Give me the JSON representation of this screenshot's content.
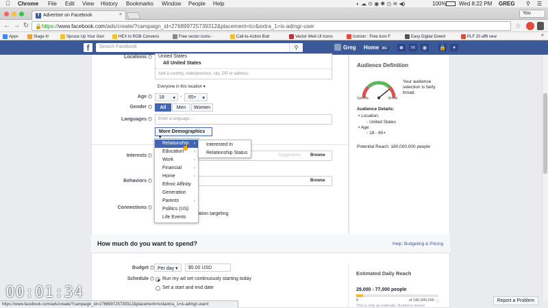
{
  "menubar": {
    "app": "Chrome",
    "items": [
      "File",
      "Edit",
      "View",
      "History",
      "Bookmarks",
      "Window",
      "People",
      "Help"
    ],
    "battery": "100%",
    "clock": "Wed 8:22 PM",
    "user": "GREG"
  },
  "tab": {
    "title": "Advertise on Facebook",
    "close": "×"
  },
  "profile": "You",
  "address": {
    "scheme": "https://",
    "host": "www.facebook.com",
    "path": "/ads/create/?campaign_id=276899725739312&placement=tcr&extra_1=is-admgr-user"
  },
  "bookmarks": [
    {
      "label": "Apps",
      "color": "#4285f4"
    },
    {
      "label": "Stage it!",
      "color": "#e8a33d"
    },
    {
      "label": "Spruce Up Your Gen",
      "color": "#f1c232"
    },
    {
      "label": "HEX to RGB Conversi",
      "color": "#f1c232"
    },
    {
      "label": "Free vector icons -",
      "color": "#888888"
    },
    {
      "label": "Call-to-Action Butt",
      "color": "#f1c232"
    },
    {
      "label": "Vector Web UI Icons",
      "color": "#b3363e"
    },
    {
      "label": "Iconion : Free Icon F",
      "color": "#e04b3a"
    },
    {
      "label": "Easy Digital Downl",
      "color": "#555555"
    },
    {
      "label": "PLF 20 affil new",
      "color": "#e04b3a"
    }
  ],
  "fb": {
    "search_placeholder": "Search Facebook",
    "user": "Greg",
    "home": "Home",
    "home_count": "20+"
  },
  "form": {
    "locations_label": "Locations",
    "location_country": "United States",
    "location_selected": "All United States",
    "location_placeholder": "Add a country, state/province, city, ZIP or address",
    "location_scope": "Everyone in this location",
    "age_label": "Age",
    "age_min": "18",
    "age_dash": "-",
    "age_max": "65+",
    "gender_label": "Gender",
    "gender_options": [
      "All",
      "Men",
      "Women"
    ],
    "languages_label": "Languages",
    "language_placeholder": "Enter a language...",
    "more_demographics": "More Demographics",
    "interests_label": "Interests",
    "suggestions": "Suggestions",
    "browse": "Browse",
    "behaviors_label": "Behaviors",
    "connections_label": "Connections",
    "connections_fragment": "ation targeting"
  },
  "demographics_menu": {
    "items": [
      {
        "label": "Relationship",
        "sub": true
      },
      {
        "label": "Education",
        "sub": true
      },
      {
        "label": "Work",
        "sub": true
      },
      {
        "label": "Financial",
        "sub": true
      },
      {
        "label": "Home",
        "sub": true
      },
      {
        "label": "Ethnic Affinity",
        "sub": false
      },
      {
        "label": "Generation",
        "sub": false
      },
      {
        "label": "Parents",
        "sub": true
      },
      {
        "label": "Politics (US)",
        "sub": false
      },
      {
        "label": "Life Events",
        "sub": false
      }
    ],
    "submenu": [
      "Interested In",
      "Relationship Status"
    ]
  },
  "audience": {
    "title": "Audience Definition",
    "gauge_note": "Your audience selection is fairly broad.",
    "specific": "Specific",
    "broad": "Broad",
    "details_title": "Audience Details:",
    "location_label": "Location:",
    "location_value": "United States",
    "age_label": "Age:",
    "age_value": "18 - 65+",
    "reach": "Potential Reach: 180,000,000 people",
    "gauge_level": 0.78
  },
  "spend": {
    "heading": "How much do you want to spend?",
    "help": "Help: Budgeting & Pricing",
    "budget_label": "Budget",
    "budget_period": "Per day",
    "budget_amount": "$5.00 USD",
    "schedule_label": "Schedule",
    "schedule_opt1": "Run my ad set continuously starting today",
    "schedule_opt2": "Set a start and end date",
    "reach_title": "Estimated Daily Reach",
    "reach_value": "29,000 - 77,000 people",
    "reach_min": "0",
    "reach_max": "of 180,000,000",
    "reach_note": "This is only an estimate. Numbers shown",
    "reach_fill": 0.08
  },
  "timer": "00:01:34",
  "status_url": "https://www.facebook.com/ads/create/?campaign_id=276899725739312&placement=tcr&extra_1=is-admgr-user#",
  "report": "Report a Problem"
}
